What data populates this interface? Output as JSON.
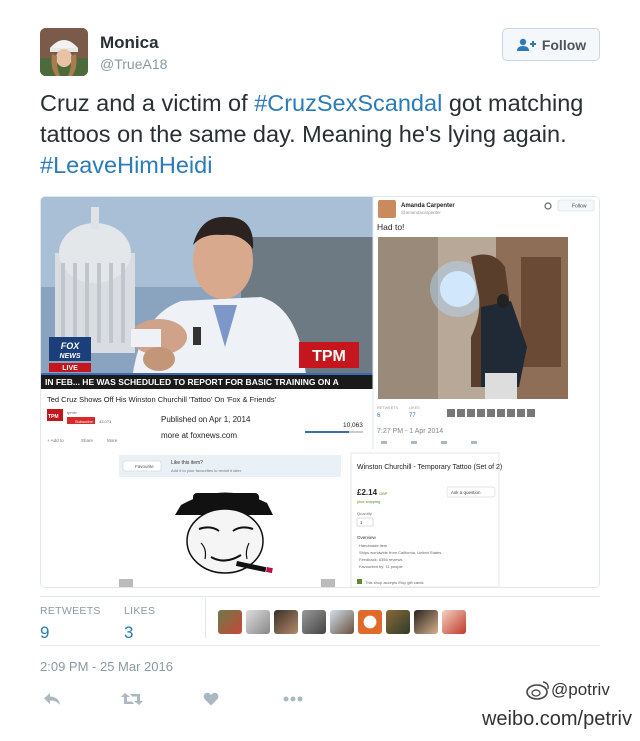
{
  "tweet": {
    "author_name": "Monica",
    "author_handle": "@TrueA18",
    "follow_label": "Follow",
    "text_parts": [
      {
        "text": "Cruz and a victim of ",
        "tag": false
      },
      {
        "text": "#CruzSexScandal",
        "tag": true
      },
      {
        "text": " got matching tattoos on the same day. Meaning he's lying again. ",
        "tag": false
      },
      {
        "text": "#LeaveHimHeidi",
        "tag": true
      }
    ],
    "stats": {
      "retweets_label": "RETWEETS",
      "retweets_value": "9",
      "likes_label": "LIKES",
      "likes_value": "3"
    },
    "timestamp": "2:09 PM - 25 Mar 2016"
  },
  "media": {
    "news_overlay": {
      "network": "FOX NEWS",
      "live": "LIVE",
      "ticker": "IN FEB... HE WAS SCHEDULED TO REPORT FOR BASIC TRAINING ON A",
      "badge": "TPM"
    },
    "video_title": "Ted Cruz Shows Off His Winston Churchill 'Tattoo' On 'Fox & Friends'",
    "video_channel": "tpmtv",
    "subscribe_label": "Subscribe",
    "sub_count": "43,073",
    "published": "Published on Apr 1, 2014",
    "more_at": "more at foxnews.com",
    "views": "10,063",
    "add_to": "+ Add to",
    "share": "Share",
    "more": "More",
    "inner_tweet": {
      "name": "Amanda Carpenter",
      "handle": "@amandacarpenter",
      "follow": "Follow",
      "text": "Had to!",
      "retweets_label": "RETWEETS",
      "retweets_value": "6",
      "likes_label": "LIKES",
      "likes_value": "77",
      "time": "7:27 PM - 1 Apr 2014"
    },
    "etsy": {
      "fav_button": "Favourite",
      "fav_title": "Like this item?",
      "fav_sub": "Add it to your favourites to revisit it later.",
      "product_title": "Winston Churchill - Temporary Tattoo (Set of 2)",
      "price": "£2.14",
      "currency": "GBP",
      "shipping": "plus shipping",
      "ask": "Ask a question",
      "quantity_label": "Quantity",
      "quantity_value": "1",
      "overview_title": "Overview",
      "overview": [
        "Handmade item",
        "Ships worldwide from California, United States",
        "Feedback: 6356 reviews",
        "Favourited by: 11 people"
      ],
      "policy": "This shop accepts Etsy gift cards"
    }
  },
  "watermark": {
    "handle": "@potriv",
    "url": "weibo.com/petriv"
  },
  "colors": {
    "link": "#2b7bb9",
    "muted": "#8899a6",
    "border": "#e1e8ed",
    "tpm_red": "#c4161c"
  }
}
